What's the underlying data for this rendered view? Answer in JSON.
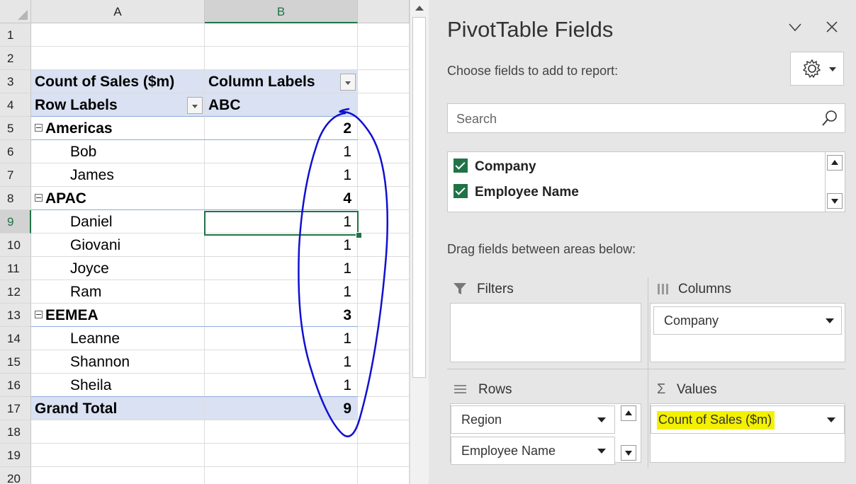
{
  "sheet": {
    "columns": [
      "A",
      "B"
    ],
    "rows": [
      {
        "n": "1",
        "a": "",
        "b": ""
      },
      {
        "n": "2",
        "a": "",
        "b": ""
      },
      {
        "n": "3",
        "a": "Count of Sales ($m)",
        "b": "Column Labels"
      },
      {
        "n": "4",
        "a": "Row Labels",
        "b": "ABC"
      },
      {
        "n": "5",
        "a": "Americas",
        "b": "2"
      },
      {
        "n": "6",
        "a": "Bob",
        "b": "1"
      },
      {
        "n": "7",
        "a": "James",
        "b": "1"
      },
      {
        "n": "8",
        "a": "APAC",
        "b": "4"
      },
      {
        "n": "9",
        "a": "Daniel",
        "b": "1"
      },
      {
        "n": "10",
        "a": "Giovani",
        "b": "1"
      },
      {
        "n": "11",
        "a": "Joyce",
        "b": "1"
      },
      {
        "n": "12",
        "a": "Ram",
        "b": "1"
      },
      {
        "n": "13",
        "a": "EEMEA",
        "b": "3"
      },
      {
        "n": "14",
        "a": "Leanne",
        "b": "1"
      },
      {
        "n": "15",
        "a": "Shannon",
        "b": "1"
      },
      {
        "n": "16",
        "a": "Sheila",
        "b": "1"
      },
      {
        "n": "17",
        "a": "Grand Total",
        "b": "9"
      },
      {
        "n": "18",
        "a": "",
        "b": ""
      },
      {
        "n": "19",
        "a": "",
        "b": ""
      },
      {
        "n": "20",
        "a": "",
        "b": ""
      }
    ],
    "selected_cell": "B9",
    "ink_color": "#1010d0"
  },
  "pane": {
    "title": "PivotTable Fields",
    "choose_label": "Choose fields to add to report:",
    "search_placeholder": "Search",
    "fields": [
      "Company",
      "Employee Name"
    ],
    "drag_label": "Drag fields between areas below:",
    "filters_label": "Filters",
    "columns_label": "Columns",
    "rows_label": "Rows",
    "values_label": "Values",
    "columns_items": [
      "Company"
    ],
    "rows_items": [
      "Region",
      "Employee Name"
    ],
    "values_items": [
      "Count of Sales ($m)"
    ],
    "highlight_color": "#f3f000",
    "check_color": "#217346"
  }
}
